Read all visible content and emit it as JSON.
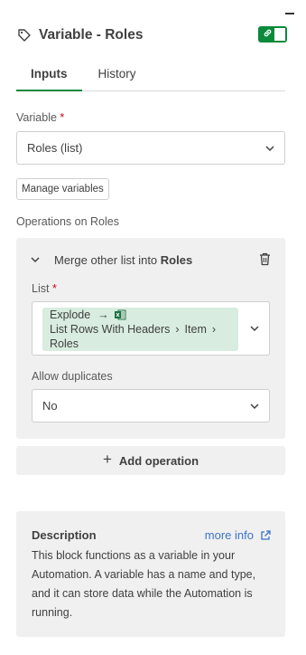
{
  "header": {
    "title": "Variable - Roles",
    "tag_icon": "tag-icon",
    "toggle_state": "on",
    "toggle_icon": "link-icon",
    "accent_color": "#0b8a3c"
  },
  "tabs": [
    {
      "label": "Inputs",
      "active": true
    },
    {
      "label": "History",
      "active": false
    }
  ],
  "variable": {
    "label": "Variable",
    "required_mark": "*",
    "selected": "Roles (list)"
  },
  "manage_variables_label": "Manage variables",
  "operations": {
    "section_label": "Operations on Roles",
    "items": [
      {
        "title_prefix": "Merge other list into",
        "title_target": "Roles",
        "list": {
          "label": "List",
          "required_mark": "*",
          "pill": {
            "line1": "Explode",
            "arrow": "→",
            "app_icon": "excel-icon",
            "path": [
              "List Rows With Headers",
              "Item",
              "Roles"
            ],
            "separator": "›"
          }
        },
        "allow_duplicates": {
          "label": "Allow duplicates",
          "selected": "No"
        }
      }
    ],
    "add_label": "Add operation"
  },
  "description": {
    "title": "Description",
    "more_info": "more info",
    "body": "This block functions as a variable in your Automation. A variable has a name and type, and it can store data while the Automation is running."
  }
}
